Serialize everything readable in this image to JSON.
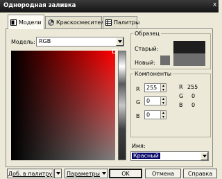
{
  "window": {
    "title": "Однородная заливка",
    "close_glyph": "x"
  },
  "tabs": [
    {
      "label": "Модели",
      "icon": "models-icon",
      "active": true
    },
    {
      "label": "Краскосмесители",
      "icon": "mixers-icon",
      "active": false
    },
    {
      "label": "Палитры",
      "icon": "palettes-icon",
      "active": false
    }
  ],
  "model": {
    "label": "Модель:",
    "value": "RGB"
  },
  "sample": {
    "group_label": "Образец",
    "old_label": "Старый:",
    "new_label": "Новый:",
    "old_color": "#1e1e1e",
    "new_color": "#6e6e6e"
  },
  "components": {
    "group_label": "Компоненты",
    "inputs": [
      {
        "letter": "R",
        "value": "255"
      },
      {
        "letter": "G",
        "value": "0"
      },
      {
        "letter": "B",
        "value": "0"
      }
    ],
    "readouts": [
      {
        "letter": "R",
        "value": "255"
      },
      {
        "letter": "G",
        "value": "0"
      },
      {
        "letter": "B",
        "value": "0"
      }
    ]
  },
  "name": {
    "label": "Имя:",
    "value": "Красный"
  },
  "buttons": {
    "add_to_palette": "Доб. в палитру",
    "options": "Параметры",
    "ok": "OK",
    "cancel": "Отмена",
    "help": "Справка"
  },
  "colors": {
    "selected": "#ff0000",
    "title_bar": "#1e1e1e",
    "dialog_bg": "#ece9d8"
  }
}
